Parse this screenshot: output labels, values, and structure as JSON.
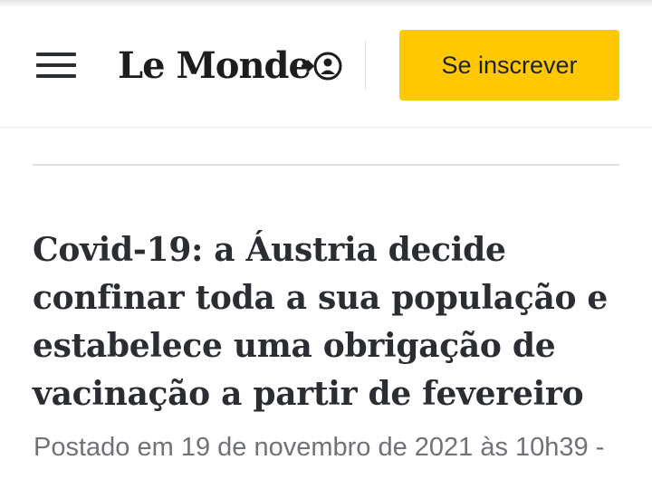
{
  "header": {
    "logo_text": "Le Monde",
    "subscribe_label": "Se inscrever",
    "icons": {
      "menu": "hamburger-menu-icon",
      "account": "account-login-icon"
    }
  },
  "article": {
    "headline": "Covid-19: a Áustria decide confinar toda a sua população e estabelece uma obrigação de vacinação a partir de fevereiro",
    "byline": "Postado em 19 de novembro de 2021 às 10h39 -"
  },
  "colors": {
    "subscribe_bg": "#ffc800",
    "text_dark": "#2a2d31",
    "text_muted": "#6f7276"
  }
}
